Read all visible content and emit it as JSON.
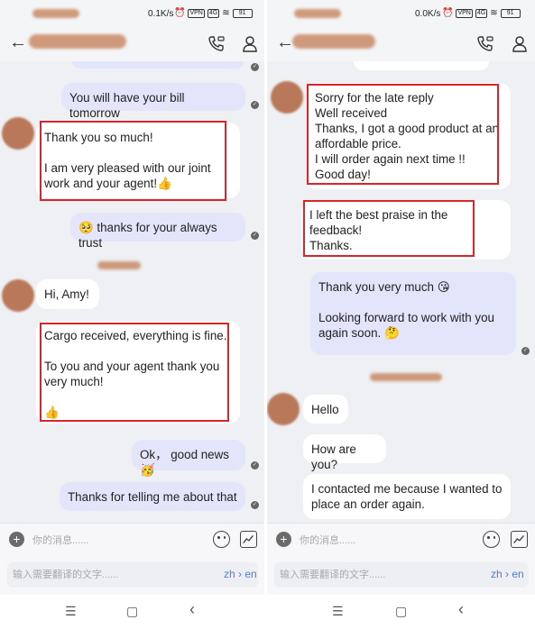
{
  "left": {
    "status": {
      "speed": "0.1K/s",
      "vpn": "VPN",
      "net": "4G",
      "battery": "91"
    },
    "messages": [
      {
        "id": "l1",
        "dir": "out",
        "text": "You will have your bill tomorrow"
      },
      {
        "id": "l2",
        "dir": "in",
        "text": "Thank you so much!\n\nI am very pleased with our joint work and your agent!👍"
      },
      {
        "id": "l3",
        "dir": "out",
        "text": "🥺 thanks for your always trust"
      },
      {
        "id": "l4",
        "dir": "in",
        "text": "Hi, Amy!"
      },
      {
        "id": "l5",
        "dir": "in",
        "text": "Cargo received, everything is fine.\n\nTo you and your agent thank you very much!\n\n👍"
      },
      {
        "id": "l6",
        "dir": "out",
        "text": "Ok， good news 🥳"
      },
      {
        "id": "l7",
        "dir": "out",
        "text": "Thanks for telling me about that"
      }
    ],
    "input_placeholder": "你的消息......",
    "translate_placeholder": "输入需要翻译的文字......",
    "lang": "zh › en"
  },
  "right": {
    "status": {
      "speed": "0.0K/s",
      "vpn": "VPN",
      "net": "4G",
      "battery": "91"
    },
    "messages": [
      {
        "id": "r1",
        "dir": "in",
        "text": "Sorry for the late reply\nWell received\nThanks, I got a good product at an affordable price.\nI will order again next time !!\nGood day!"
      },
      {
        "id": "r2",
        "dir": "in",
        "text": "I left the best praise in the feedback!\nThanks."
      },
      {
        "id": "r3",
        "dir": "out",
        "text": "Thank you very much 😘\n\nLooking forward to work with you again soon. 🤔"
      },
      {
        "id": "r4",
        "dir": "in",
        "text": "Hello"
      },
      {
        "id": "r5",
        "dir": "in",
        "text": "How are you?"
      },
      {
        "id": "r6",
        "dir": "in",
        "text": "I contacted me because I wanted to place an order again."
      }
    ],
    "input_placeholder": "你的消息......",
    "translate_placeholder": "输入需要翻译的文字......",
    "lang": "zh › en"
  },
  "nav": {
    "menu": "☰",
    "home": "▢",
    "back": "‹"
  },
  "icons": {
    "back": "arrow-left-icon",
    "call": "phone-video-icon",
    "profile": "person-icon",
    "add": "plus-circle-icon",
    "emoji": "smiley-icon",
    "chart": "chart-icon",
    "read": "read-check-icon"
  },
  "colors": {
    "outgoing_bubble": "#e3e5fb",
    "incoming_bubble": "#ffffff",
    "highlight": "#d6262b",
    "background": "#eef0f3"
  }
}
